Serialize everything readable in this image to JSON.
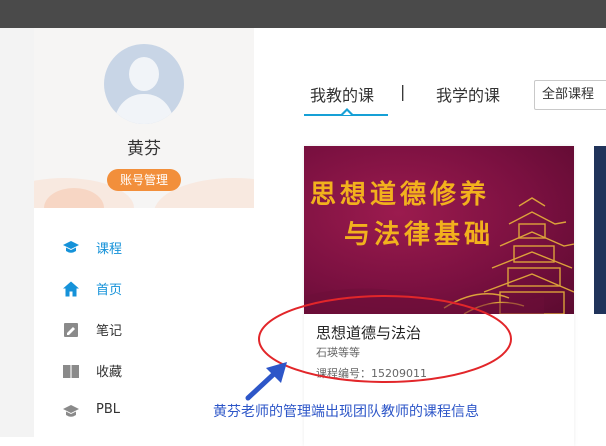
{
  "user": {
    "name": "黄芬",
    "account_button": "账号管理"
  },
  "nav": [
    {
      "label": "课程",
      "icon": "course-icon",
      "active": true
    },
    {
      "label": "首页",
      "icon": "home-icon",
      "active": false
    },
    {
      "label": "笔记",
      "icon": "note-icon",
      "active": false
    },
    {
      "label": "收藏",
      "icon": "book-icon",
      "active": false
    },
    {
      "label": "PBL",
      "icon": "pbl-icon",
      "active": false
    }
  ],
  "tabs": {
    "teach": "我教的课",
    "separator": "|",
    "learn": "我学的课"
  },
  "filter": {
    "selected": "全部课程"
  },
  "course": {
    "cover_line1": "思想道德修养",
    "cover_line2": "与法律基础",
    "title": "思想道德与法治",
    "teacher": "石瑛等等",
    "code": "课程编号：15209011"
  },
  "annotation": {
    "text": "黄芬老师的管理端出现团队教师的课程信息"
  },
  "colors": {
    "accent": "#16a0d6",
    "account_button": "#f28f3b",
    "annotation": "#2d56c8",
    "ellipse": "#e2262a"
  }
}
